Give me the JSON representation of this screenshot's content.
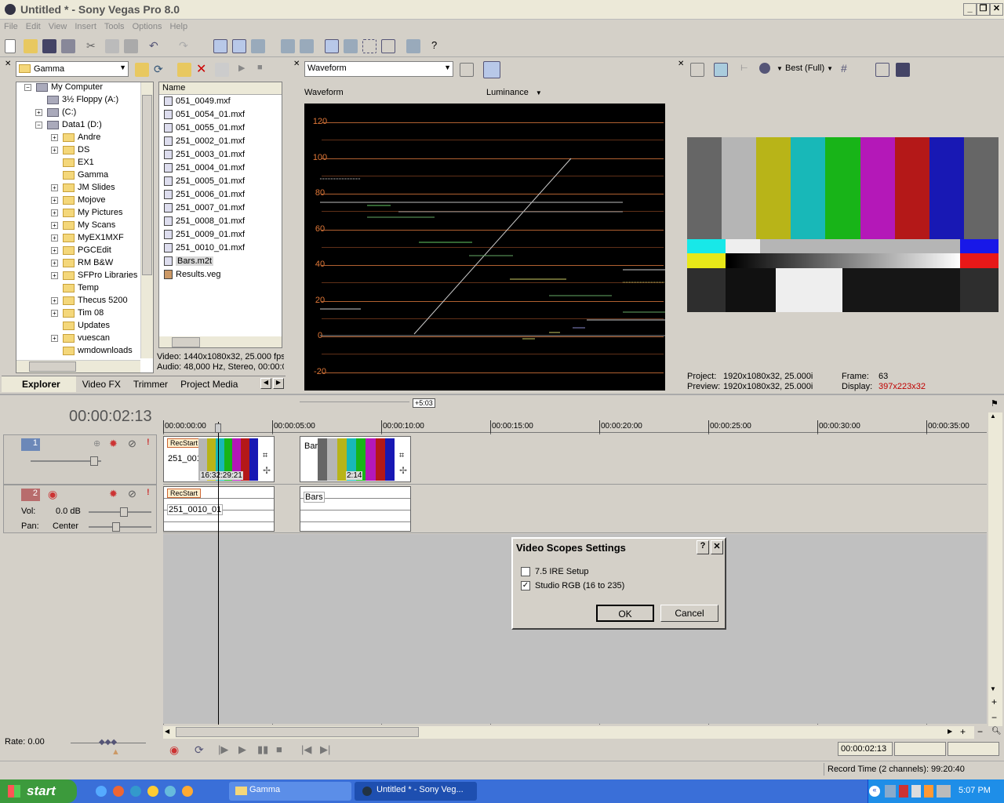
{
  "window": {
    "title": "Untitled * - Sony Vegas Pro 8.0"
  },
  "menu": [
    "File",
    "Edit",
    "View",
    "Insert",
    "Tools",
    "Options",
    "Help"
  ],
  "explorer": {
    "location": "Gamma",
    "tree": [
      {
        "label": "My Computer",
        "indent": 0
      },
      {
        "label": "3½ Floppy (A:)",
        "indent": 1
      },
      {
        "label": "(C:)",
        "indent": 1
      },
      {
        "label": "Data1 (D:)",
        "indent": 1
      },
      {
        "label": "Andre",
        "indent": 2
      },
      {
        "label": "DS",
        "indent": 2
      },
      {
        "label": "EX1",
        "indent": 2
      },
      {
        "label": "Gamma",
        "indent": 2
      },
      {
        "label": "JM Slides",
        "indent": 2
      },
      {
        "label": "Mojove",
        "indent": 2
      },
      {
        "label": "My Pictures",
        "indent": 2
      },
      {
        "label": "My Scans",
        "indent": 2
      },
      {
        "label": "MyEX1MXF",
        "indent": 2
      },
      {
        "label": "PGCEdit",
        "indent": 2
      },
      {
        "label": "RM B&W",
        "indent": 2
      },
      {
        "label": "SFPro Libraries",
        "indent": 2
      },
      {
        "label": "Temp",
        "indent": 2
      },
      {
        "label": "Thecus 5200",
        "indent": 2
      },
      {
        "label": "Tim 08",
        "indent": 2
      },
      {
        "label": "Updates",
        "indent": 2
      },
      {
        "label": "vuescan",
        "indent": 2
      },
      {
        "label": "wmdownloads",
        "indent": 2
      }
    ],
    "name_header": "Name",
    "files": [
      "051_0049.mxf",
      "051_0054_01.mxf",
      "051_0055_01.mxf",
      "251_0002_01.mxf",
      "251_0003_01.mxf",
      "251_0004_01.mxf",
      "251_0005_01.mxf",
      "251_0006_01.mxf",
      "251_0007_01.mxf",
      "251_0008_01.mxf",
      "251_0009_01.mxf",
      "251_0010_01.mxf",
      "Bars.m2t",
      "Results.veg"
    ],
    "info_video": "Video: 1440x1080x32, 25.000 fps",
    "info_audio": "Audio: 48,000 Hz, Stereo, 00:00:0",
    "tabs": [
      "Explorer",
      "Video FX",
      "Trimmer",
      "Project Media"
    ]
  },
  "scope": {
    "mode": "Waveform",
    "label": "Waveform",
    "channel": "Luminance",
    "ire_labels": [
      "120",
      "100",
      "80",
      "60",
      "40",
      "20",
      "0",
      "-20"
    ]
  },
  "preview": {
    "quality": "Best (Full)",
    "project_label": "Project:",
    "project_value": "1920x1080x32, 25.000i",
    "preview_label": "Preview:",
    "preview_value": "1920x1080x32, 25.000i",
    "frame_label": "Frame:",
    "frame_value": "63",
    "display_label": "Display:",
    "display_value": "397x223x32",
    "display_color": "#c00000"
  },
  "timeline": {
    "timecode": "00:00:02:13",
    "offset_badge": "+5:03",
    "ruler": [
      "00:00:00:00",
      "00:00:05:00",
      "00:00:10:00",
      "00:00:15:00",
      "00:00:20:00",
      "00:00:25:00",
      "00:00:30:00",
      "00:00:35:00"
    ],
    "video_track_num": "1",
    "audio_track_num": "2",
    "vol_label": "Vol:",
    "vol_value": "0.0 dB",
    "pan_label": "Pan:",
    "pan_value": "Center",
    "clip1_tag": "RecStart",
    "clip1_name": "251_0010_01",
    "clip1_tc": "16:32:29:21",
    "clip2_name": "Bars",
    "clip2_tc": "2:14",
    "audio_clip1_tag": "RecStart",
    "audio_clip1_name": "251_0010_01",
    "audio_clip2_name": "Bars",
    "rate": "Rate: 0.00",
    "end_timecode": "00:00:02:13",
    "record_time": "Record Time (2 channels): 99:20:40"
  },
  "dialog": {
    "title": "Video Scopes Settings",
    "option1": "7.5 IRE Setup",
    "option1_checked": false,
    "option2": "Studio RGB (16 to 235)",
    "option2_checked": true,
    "ok": "OK",
    "cancel": "Cancel"
  },
  "taskbar": {
    "start": "start",
    "task1": "Gamma",
    "task2": "Untitled * - Sony Veg...",
    "clock": "5:07 PM"
  }
}
